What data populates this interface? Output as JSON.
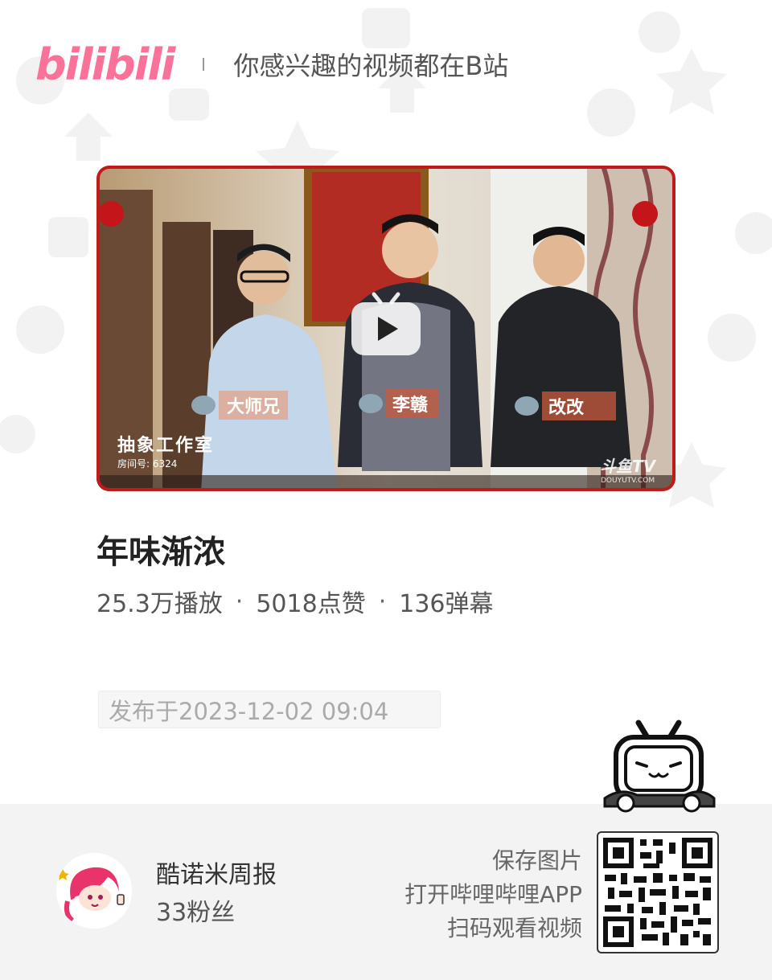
{
  "header": {
    "logo_text": "bilibili",
    "slogan": "你感兴趣的视频都在B站",
    "brand_color": "#fb7299"
  },
  "video": {
    "overlay": {
      "name_tag_1": "大师兄",
      "name_tag_2": "李赣",
      "name_tag_3": "改改",
      "studio_name": "抽象工作室",
      "room_number": "房间号: 6324",
      "watermark_main": "斗鱼TV",
      "watermark_sub": "DOUYUTV.COM"
    },
    "title": "年味渐浓",
    "stats": {
      "plays": "25.3万播放",
      "likes": "5018点赞",
      "danmaku": "136弹幕",
      "separator": "·"
    },
    "publish_time": "发布于2023-12-02 09:04"
  },
  "footer": {
    "uploader_name": "酷诺米周报",
    "fans": "33粉丝",
    "hint_lines": {
      "line1": "保存图片",
      "line2": "打开哔哩哔哩APP",
      "line3": "扫码观看视频"
    }
  },
  "icons": {
    "play": "play-icon",
    "mascot": "bilibili-tv-mascot-icon",
    "qr": "qr-code-icon",
    "avatar": "uploader-avatar-icon"
  }
}
